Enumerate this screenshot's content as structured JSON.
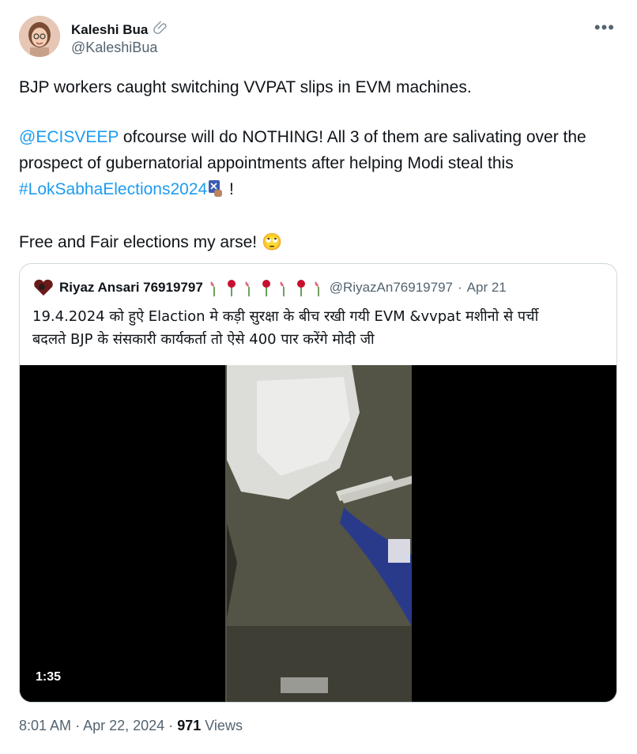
{
  "author": {
    "display_name": "Kaleshi Bua",
    "handle": "@KaleshiBua",
    "badge_icon": "paperclip-icon"
  },
  "tweet": {
    "line1": "BJP workers caught switching VVPAT slips in EVM machines.",
    "mention": "@ECISVEEP",
    "line2_rest": " ofcourse will do NOTHING! All 3 of them are salivating over the prospect of gubernatorial appointments after helping Modi steal this ",
    "hashtag": "#LokSabhaElections2024",
    "after_hashtag": " !",
    "line3": "Free and Fair elections my arse! ",
    "emoji": "🙄"
  },
  "quoted": {
    "display_name": "Riyaz Ansari 76919797",
    "handle": "@RiyazAn76919797",
    "separator": "·",
    "date": "Apr 21",
    "text_line1": "19.4.2024  को हुऐ Elaction  मे  कड़ी सुरक्षा के बीच रखी गयी EVM  &vvpat  मशीनो  से पर्ची",
    "text_line2": "बदलते  BJP के संसकारी कार्यकर्ता  तो  ऐसे 400 पार करेंगे मोदी जी",
    "video_duration": "1:35"
  },
  "meta": {
    "time": "8:01 AM",
    "separator": "·",
    "date": "Apr 22, 2024",
    "separator2": "·",
    "views_count": "971",
    "views_label": "Views"
  },
  "colors": {
    "link": "#1d9bf0",
    "secondary_text": "#536471",
    "border": "#cfd9de"
  }
}
